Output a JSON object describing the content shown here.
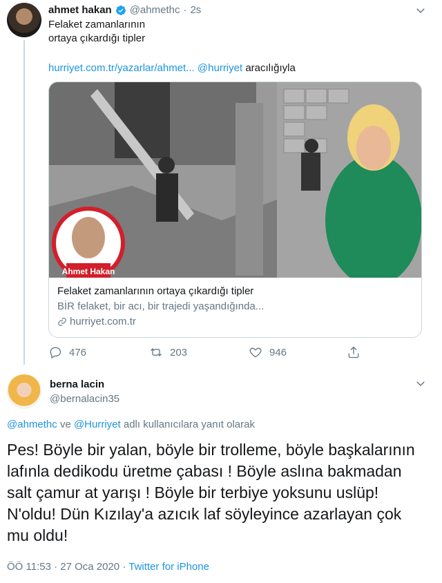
{
  "tweet1": {
    "author_name": "ahmet hakan",
    "author_handle": "@ahmethc",
    "separator": "·",
    "time_ago": "2s",
    "text_line1": "Felaket zamanlarının",
    "text_line2": "ortaya çıkardığı tipler",
    "link_url": "hurriyet.com.tr/yazarlar/ahmet...",
    "link_mention": "@hurriyet",
    "link_via": "aracılığıyla",
    "card": {
      "image_caption": "Ahmet Hakan",
      "title": "Felaket zamanlarının ortaya çıkardığı tipler",
      "description": "BİR felaket, bir acı, bir trajedi yaşandığında...",
      "domain": "hurriyet.com.tr"
    },
    "actions": {
      "reply_count": "476",
      "retweet_count": "203",
      "like_count": "946"
    }
  },
  "tweet2": {
    "author_name": "berna lacin",
    "author_handle": "@bernalacin35",
    "reply_mention1": "@ahmethc",
    "reply_and": "ve",
    "reply_mention2": "@Hurriyet",
    "reply_suffix": "adlı kullanıcılara yanıt olarak",
    "body": "Pes! Böyle bir yalan, böyle bir trolleme, böyle başkalarının lafınla dedikodu üretme çabası ! Böyle aslına bakmadan salt çamur at yarışı ! Böyle bir terbiye yoksunu uslüp! N'oldu! Dün Kızılay'a azıcık laf söyleyince azarlayan çok mu oldu!",
    "timestamp": "ÖÖ 11:53 · 27 Oca 2020 ·",
    "source": "Twitter for iPhone"
  },
  "colors": {
    "link": "#1b95e0",
    "secondary_text": "#657786",
    "border": "#ccd6dd",
    "verified": "#1da1f2"
  }
}
